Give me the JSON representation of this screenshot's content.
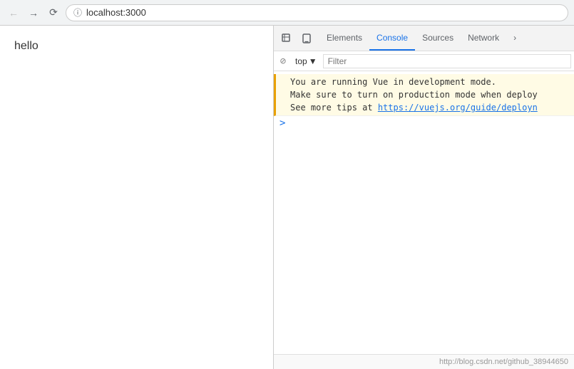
{
  "browser": {
    "back_title": "Back",
    "forward_title": "Forward",
    "reload_title": "Reload",
    "address": "localhost:3000"
  },
  "page": {
    "content": "hello"
  },
  "devtools": {
    "icons": [
      "cursor-icon",
      "mobile-icon"
    ],
    "tabs": [
      {
        "label": "Elements",
        "active": false
      },
      {
        "label": "Console",
        "active": true
      },
      {
        "label": "Sources",
        "active": false
      },
      {
        "label": "Network",
        "active": false
      }
    ],
    "console_context": "top",
    "filter_placeholder": "Filter",
    "messages": [
      {
        "text": "You are running Vue in development mode.",
        "type": "warning"
      },
      {
        "text": "Make sure to turn on production mode when deploy",
        "type": "warning"
      },
      {
        "text": "See more tips at ",
        "link_text": "https://vuejs.org/guide/deployn",
        "link_url": "https://vuejs.org/guide/deployn",
        "type": "warning"
      }
    ],
    "footer_text": "http://blog.csdn.net/github_38944650"
  }
}
